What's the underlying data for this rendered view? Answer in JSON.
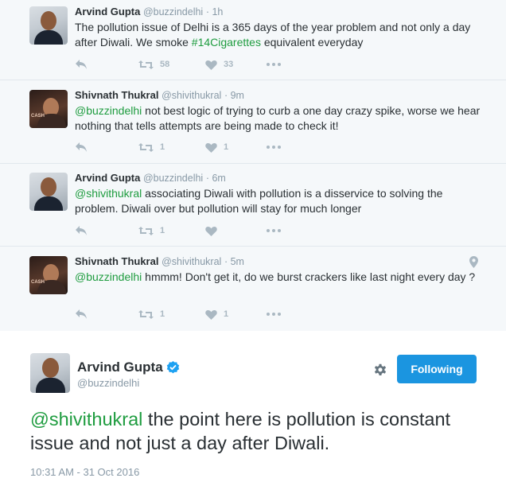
{
  "replies": [
    {
      "name": "Arvind Gupta",
      "handle": "@buzzindelhi",
      "time": "· 1h",
      "text_before": "The pollution issue of Delhi is a 365 days of the year problem and not only a day after Diwali. We smoke ",
      "mention": "#14Cigarettes",
      "text_after": " equivalent everyday",
      "retweets": "58",
      "likes": "33"
    },
    {
      "name": "Shivnath Thukral",
      "handle": "@shivithukral",
      "time": "· 9m",
      "text_before": "",
      "mention": "@buzzindelhi",
      "text_after": " not best logic of trying to curb a one day crazy spike, worse we hear nothing that tells attempts are being made to check it!",
      "retweets": "1",
      "likes": "1"
    },
    {
      "name": "Arvind Gupta",
      "handle": "@buzzindelhi",
      "time": "· 6m",
      "text_before": "",
      "mention": "@shivithukral",
      "text_after": " associating Diwali with pollution is a disservice to solving the problem. Diwali over but pollution will stay for much longer",
      "retweets": "1",
      "likes": ""
    },
    {
      "name": "Shivnath Thukral",
      "handle": "@shivithukral",
      "time": "· 5m",
      "text_before": "",
      "mention": "@buzzindelhi",
      "text_after": " hmmm! Don't get it, do we burst crackers like last night every day ?",
      "retweets": "1",
      "likes": "1"
    }
  ],
  "main": {
    "name": "Arvind Gupta",
    "handle": "@buzzindelhi",
    "follow_label": "Following",
    "mention": "@shivithukral",
    "text": " the point here is pollution is constant issue and not just a day after Diwali.",
    "timestamp": "10:31 AM - 31 Oct 2016"
  },
  "colors": {
    "link": "#1e9c3f",
    "follow_button": "#1b95e0",
    "verified": "#1da1f2",
    "muted": "#8899a6",
    "action_icon": "#aab8c2"
  },
  "avatar_caption": "CASH"
}
